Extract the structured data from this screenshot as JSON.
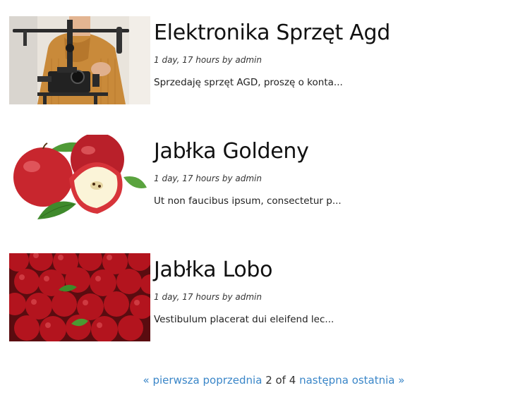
{
  "posts": [
    {
      "title": "Elektronika Sprzęt Agd",
      "meta": "1 day, 17 hours by admin",
      "excerpt": "Sprzedaję sprzęt AGD, proszę o konta...",
      "image": "photographer-with-gimbal-camera"
    },
    {
      "title": "Jabłka Goldeny",
      "meta": "1 day, 17 hours by admin",
      "excerpt": "Ut non faucibus ipsum, consectetur p...",
      "image": "red-apples-with-leaves"
    },
    {
      "title": "Jabłka Lobo",
      "meta": "1 day, 17 hours by admin",
      "excerpt": "Vestibulum placerat dui eleifend lec...",
      "image": "pile-of-red-apples"
    }
  ],
  "pagination": {
    "first": "« pierwsza",
    "prev": "poprzednia",
    "current": "2 of 4",
    "next": "następna",
    "last": "ostatnia »"
  },
  "colors": {
    "link": "#3a86c8",
    "title": "#111111",
    "text": "#222222"
  }
}
